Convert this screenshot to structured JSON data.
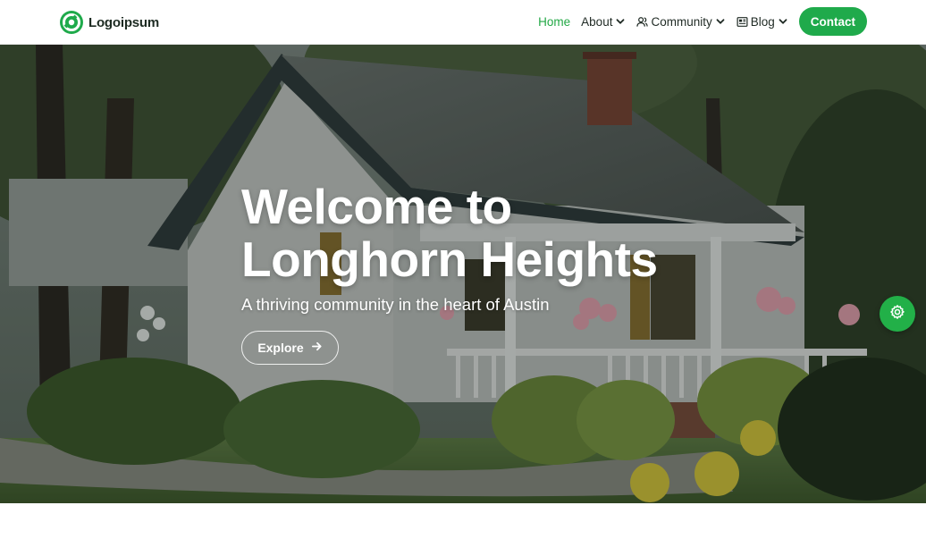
{
  "header": {
    "logo_text": "Logoipsum",
    "nav": {
      "home": "Home",
      "about": "About",
      "community": "Community",
      "blog": "Blog",
      "contact": "Contact"
    }
  },
  "hero": {
    "title_line1": "Welcome to",
    "title_line2": "Longhorn Heights",
    "subtitle": "A thriving community in the heart of Austin",
    "cta_label": "Explore"
  },
  "icons": {
    "logo": "logo-mark-icon",
    "about_chevron": "chevron-down-icon",
    "community": "users-icon",
    "blog": "newspaper-icon",
    "cta_arrow": "arrow-right-icon",
    "settings": "gear-icon"
  },
  "colors": {
    "accent": "#1faa4b",
    "active_nav": "#22a845",
    "header_bg": "#ffffff",
    "text_dark": "#1f2a24"
  }
}
